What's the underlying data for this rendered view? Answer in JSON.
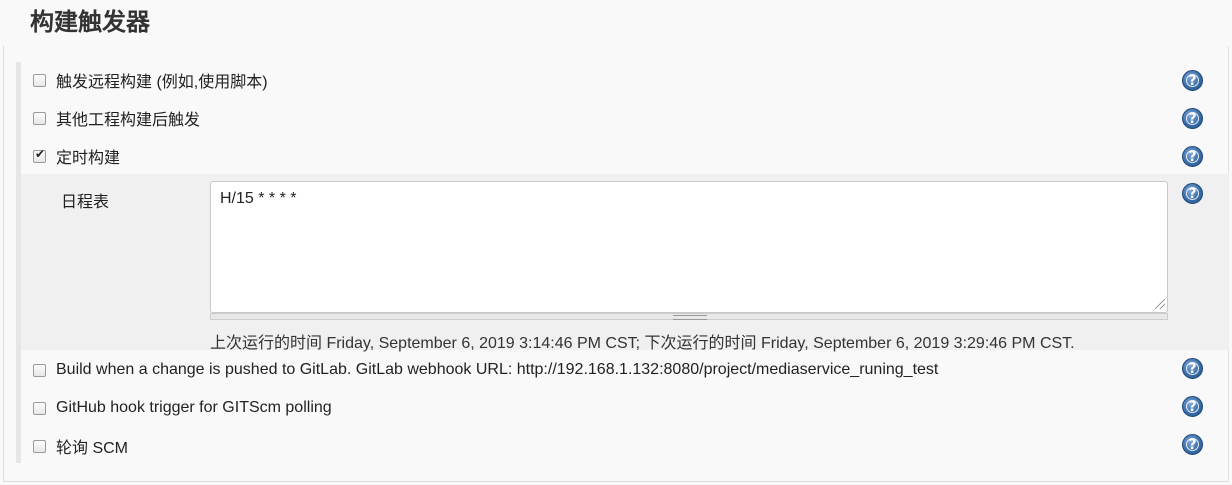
{
  "title": "构建触发器",
  "triggers_top": [
    {
      "label": "触发远程构建 (例如,使用脚本)",
      "checked": false
    },
    {
      "label": "其他工程构建后触发",
      "checked": false
    },
    {
      "label": "定时构建",
      "checked": true
    }
  ],
  "schedule": {
    "label": "日程表",
    "value": "H/15 * * * *",
    "run_info": "上次运行的时间 Friday, September 6, 2019 3:14:46 PM CST; 下次运行的时间 Friday, September 6, 2019 3:29:46 PM CST."
  },
  "triggers_bottom": [
    {
      "label": "Build when a change is pushed to GitLab. GitLab webhook URL: http://192.168.1.132:8080/project/mediaservice_runing_test",
      "checked": false
    },
    {
      "label": "GitHub hook trigger for GITScm polling",
      "checked": false
    },
    {
      "label": "轮询 SCM",
      "checked": false
    }
  ],
  "help_icon_glyph": "?",
  "icons": {
    "help": "help-icon",
    "checkbox": "checkbox-icon"
  },
  "colors": {
    "help_blue": "#3a6ea8",
    "panel_bg": "#f0f0f0",
    "page_bg": "#f9f9f9"
  }
}
